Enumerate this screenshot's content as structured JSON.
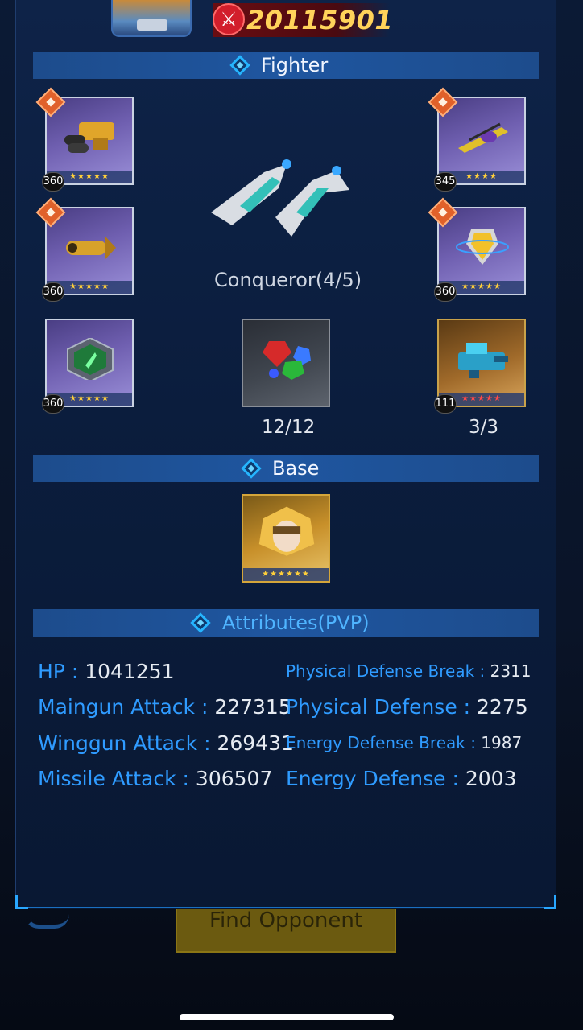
{
  "header": {
    "power": "20115901"
  },
  "fighter": {
    "title": "Fighter",
    "ship_name": "Conqueror(4/5)",
    "slots": [
      {
        "level": "360",
        "stars": "★★★★★"
      },
      {
        "level": "345",
        "stars": "★★★★"
      },
      {
        "level": "360",
        "stars": "★★★★★"
      },
      {
        "level": "360",
        "stars": "★★★★★"
      },
      {
        "level": "360",
        "stars": "★★★★★"
      },
      {
        "level": "111",
        "stars": "★★★★★"
      }
    ],
    "gems_count": "12/12",
    "module_count": "3/3"
  },
  "base": {
    "title": "Base",
    "stars": "★★★★★★"
  },
  "attributes": {
    "title": "Attributes(PVP)",
    "left": [
      {
        "label": "HP : ",
        "value": "1041251"
      },
      {
        "label": "Maingun Attack : ",
        "value": "227315"
      },
      {
        "label": "Winggun Attack : ",
        "value": "269431"
      },
      {
        "label": "Missile Attack : ",
        "value": "306507"
      }
    ],
    "right": [
      {
        "label": "Physical Defense Break : ",
        "value": "2311"
      },
      {
        "label": "Physical Defense : ",
        "value": "2275"
      },
      {
        "label": "Energy Defense Break : ",
        "value": "1987"
      },
      {
        "label": "Energy Defense : ",
        "value": "2003"
      }
    ]
  },
  "background": {
    "find_opponent": "Find Opponent"
  }
}
